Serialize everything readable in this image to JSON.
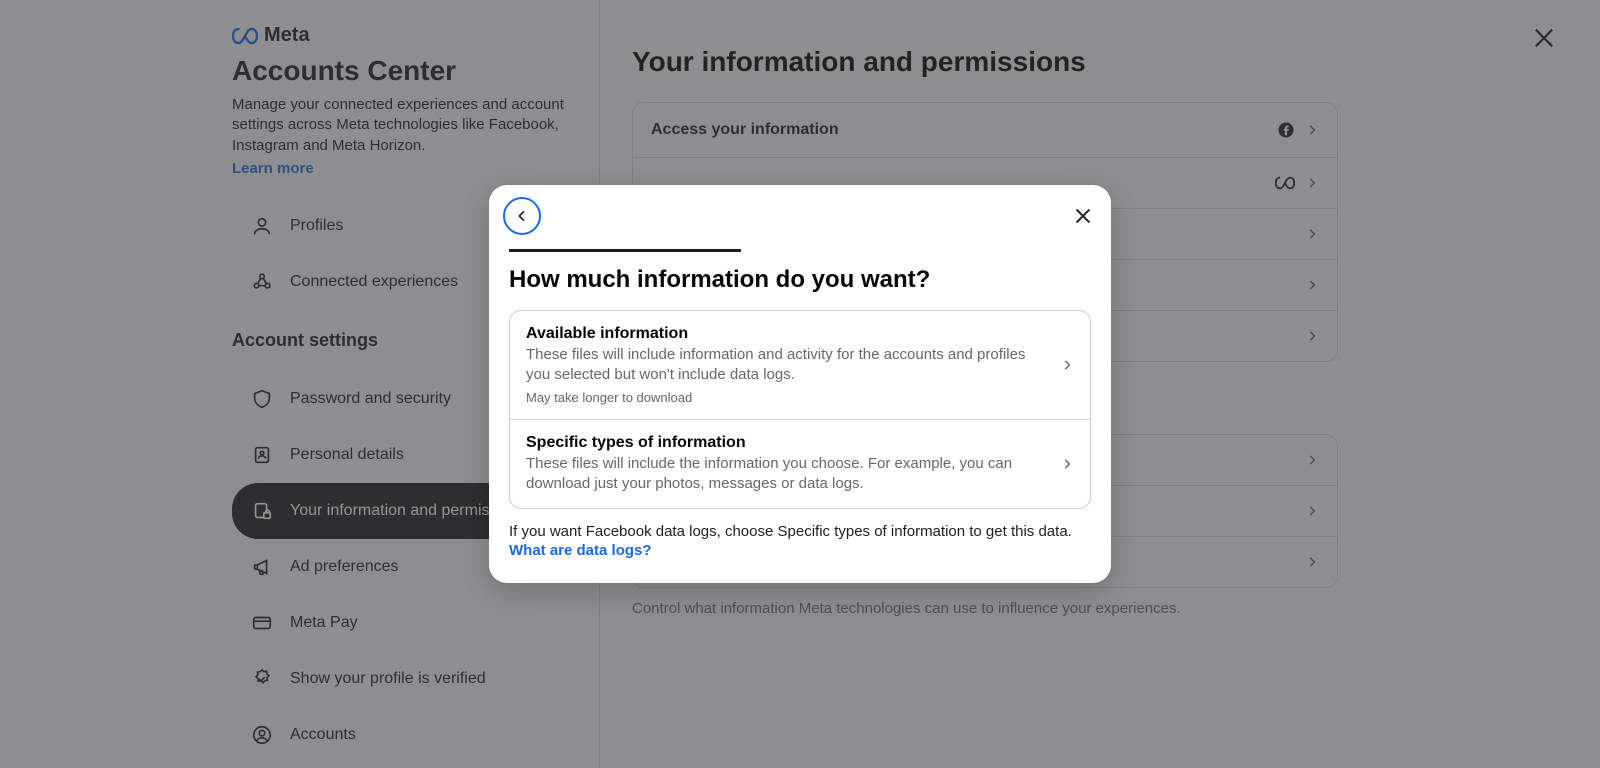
{
  "brand": {
    "name": "Meta"
  },
  "sidebar": {
    "title": "Accounts Center",
    "intro": "Manage your connected experiences and account settings across Meta technologies like Facebook, Instagram and Meta Horizon.",
    "learn_more": "Learn more",
    "top_items": [
      {
        "label": "Profiles",
        "icon": "person"
      },
      {
        "label": "Connected experiences",
        "icon": "nodes"
      }
    ],
    "section_heading": "Account settings",
    "settings_items": [
      {
        "label": "Password and security",
        "icon": "shield"
      },
      {
        "label": "Personal details",
        "icon": "id-card"
      },
      {
        "label": "Your information and permissions",
        "icon": "doc-lock",
        "active": true
      },
      {
        "label": "Ad preferences",
        "icon": "megaphone"
      },
      {
        "label": "Meta Pay",
        "icon": "credit-card"
      },
      {
        "label": "Show your profile is verified",
        "icon": "badge"
      },
      {
        "label": "Accounts",
        "icon": "user-circle"
      }
    ]
  },
  "main": {
    "title": "Your information and permissions",
    "rows": [
      {
        "label": "Access your information",
        "trailing_icon": "facebook"
      },
      {
        "label": "",
        "trailing_icon": "meta"
      },
      {
        "label": "",
        "trailing_icon": ""
      },
      {
        "label": "",
        "trailing_icon": ""
      },
      {
        "label": "",
        "trailing_icon": ""
      }
    ],
    "subtext": "Control what information Meta technologies can use to influence your experiences."
  },
  "modal": {
    "title": "How much information do you want?",
    "options": [
      {
        "title": "Available information",
        "desc": "These files will include information and activity for the accounts and profiles you selected but won't include data logs.",
        "meta": "May take longer to download"
      },
      {
        "title": "Specific types of information",
        "desc": "These files will include the information you choose. For example, you can download just your photos, messages or data logs.",
        "meta": ""
      }
    ],
    "footer_text": "If you want Facebook data logs, choose Specific types of information to get this data.",
    "footer_link": "What are data logs?"
  }
}
